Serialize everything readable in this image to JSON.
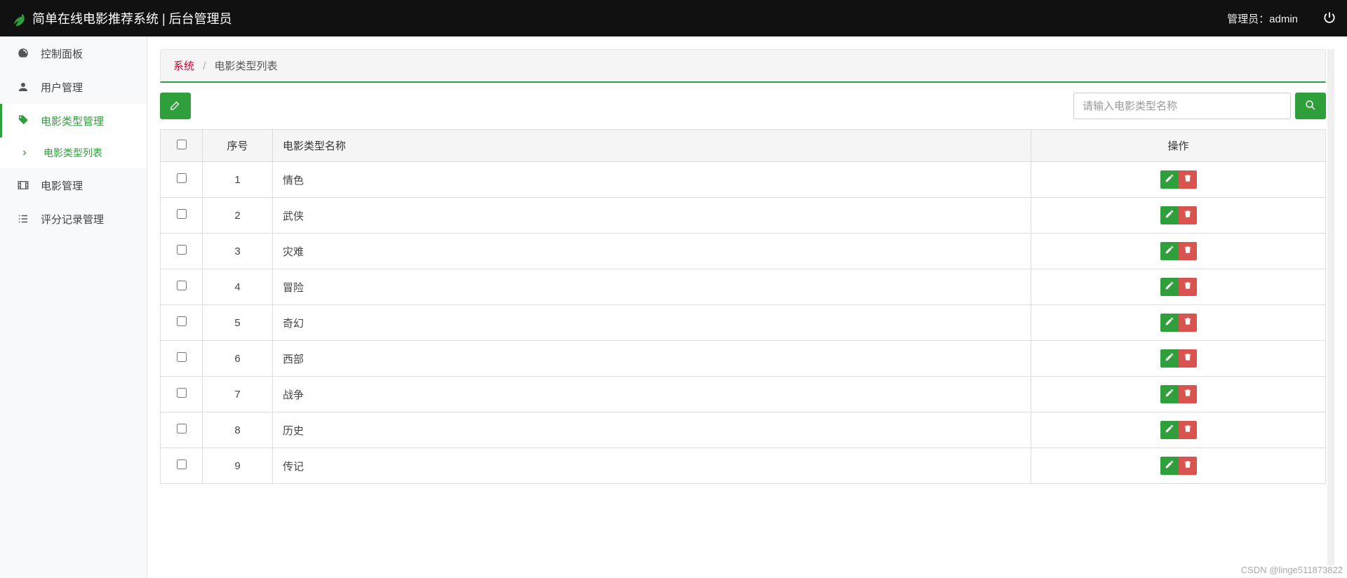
{
  "header": {
    "app_title": "简单在线电影推荐系统 | 后台管理员",
    "admin_label": "管理员：",
    "admin_name": "admin"
  },
  "sidebar": {
    "items": [
      {
        "icon": "dashboard-icon",
        "label": "控制面板"
      },
      {
        "icon": "user-icon",
        "label": "用户管理"
      },
      {
        "icon": "tags-icon",
        "label": "电影类型管理",
        "active": true
      },
      {
        "icon": "film-icon",
        "label": "电影管理"
      },
      {
        "icon": "list-icon",
        "label": "评分记录管理"
      }
    ],
    "sub": {
      "icon": "chevron-right-icon",
      "label": "电影类型列表"
    }
  },
  "breadcrumb": {
    "root": "系统",
    "current": "电影类型列表"
  },
  "search": {
    "placeholder": "请输入电影类型名称"
  },
  "table": {
    "headers": {
      "seq": "序号",
      "name": "电影类型名称",
      "ops": "操作"
    },
    "rows": [
      {
        "seq": "1",
        "name": "情色"
      },
      {
        "seq": "2",
        "name": "武侠"
      },
      {
        "seq": "3",
        "name": "灾难"
      },
      {
        "seq": "4",
        "name": "冒险"
      },
      {
        "seq": "5",
        "name": "奇幻"
      },
      {
        "seq": "6",
        "name": "西部"
      },
      {
        "seq": "7",
        "name": "战争"
      },
      {
        "seq": "8",
        "name": "历史"
      },
      {
        "seq": "9",
        "name": "传记"
      }
    ]
  },
  "watermark": "CSDN @linge511873822"
}
